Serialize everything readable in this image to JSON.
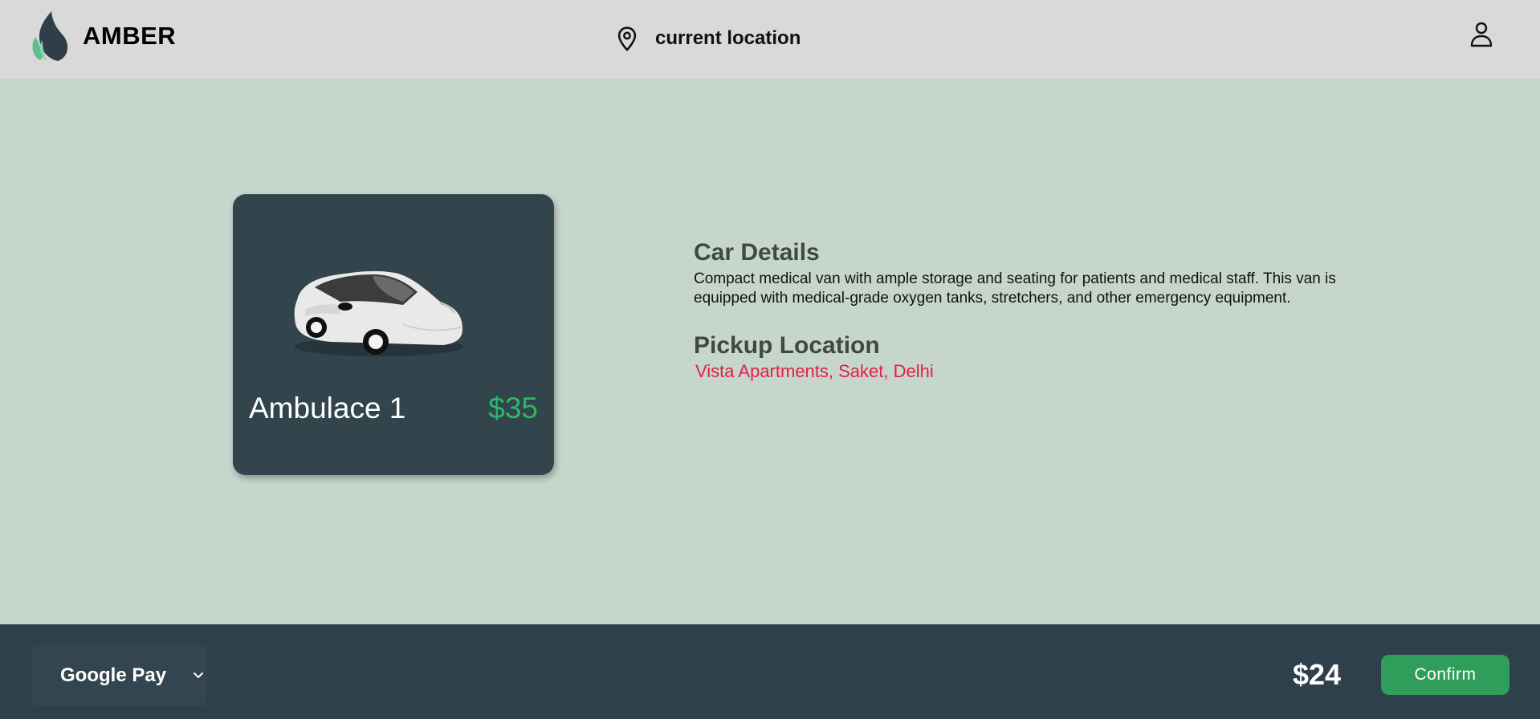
{
  "header": {
    "brand": "AMBER",
    "location_label": "current location"
  },
  "vehicle": {
    "name": "Ambulace 1",
    "price": "$35"
  },
  "details": {
    "car_details_title": "Car Details",
    "car_details_text": "Compact medical van with ample storage and seating for patients and medical staff. This van is equipped with medical-grade oxygen tanks, stretchers, and other emergency equipment.",
    "pickup_title": "Pickup Location",
    "pickup_address": "Vista Apartments, Saket, Delhi"
  },
  "footer": {
    "payment_method": "Google Pay",
    "total": "$24",
    "confirm_label": "Confirm"
  },
  "colors": {
    "header_bg": "#d9d9d9",
    "page_bg": "#c6d6cc",
    "card_bg": "#32444c",
    "footer_bg": "#2e404c",
    "price_green": "#2bb866",
    "address_red": "#e21f48",
    "confirm_green": "#2e9e5a"
  },
  "icons": {
    "logo": "flame-logo-icon",
    "location": "map-pin-icon",
    "profile": "user-icon",
    "dropdown": "chevron-down-icon"
  }
}
